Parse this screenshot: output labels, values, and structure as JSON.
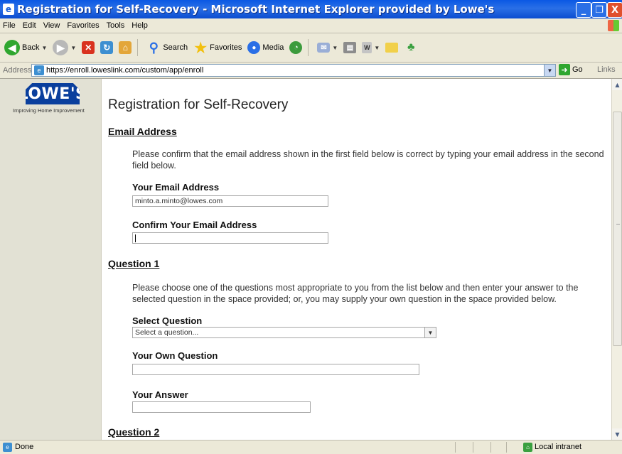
{
  "window": {
    "title": "Registration for Self-Recovery - Microsoft Internet Explorer provided by Lowe's",
    "app_icon": "e",
    "controls": {
      "minimize": "_",
      "maximize": "❐",
      "close": "X"
    }
  },
  "menu": {
    "items": [
      "File",
      "Edit",
      "View",
      "Favorites",
      "Tools",
      "Help"
    ]
  },
  "toolbar": {
    "back_label": "Back",
    "search_label": "Search",
    "favorites_label": "Favorites",
    "media_label": "Media"
  },
  "address": {
    "label": "Address",
    "url": "https://enroll.loweslink.com/custom/app/enroll",
    "go_label": "Go",
    "links_label": "Links"
  },
  "logo": {
    "text": "LOWE'S",
    "tagline": "Improving Home Improvement"
  },
  "page": {
    "title": "Registration for Self-Recovery",
    "email_section": {
      "heading": "Email Address",
      "instructions": "Please confirm that the email address shown in the first field below is correct by typing your email address in the second field below.",
      "email_label": "Your Email Address",
      "email_value": "minto.a.minto@lowes.com",
      "confirm_label": "Confirm Your Email Address",
      "confirm_value": ""
    },
    "question1": {
      "heading": "Question 1",
      "instructions": "Please choose one of the questions most appropriate to you from the list below and then enter your answer to the selected question in the space provided; or, you may supply your own question in the space provided below.",
      "select_label": "Select Question",
      "select_value": "Select a question...",
      "own_question_label": "Your Own Question",
      "own_question_value": "",
      "answer_label": "Your Answer",
      "answer_value": ""
    },
    "question2": {
      "heading": "Question 2"
    }
  },
  "status": {
    "text": "Done",
    "zone": "Local intranet"
  }
}
